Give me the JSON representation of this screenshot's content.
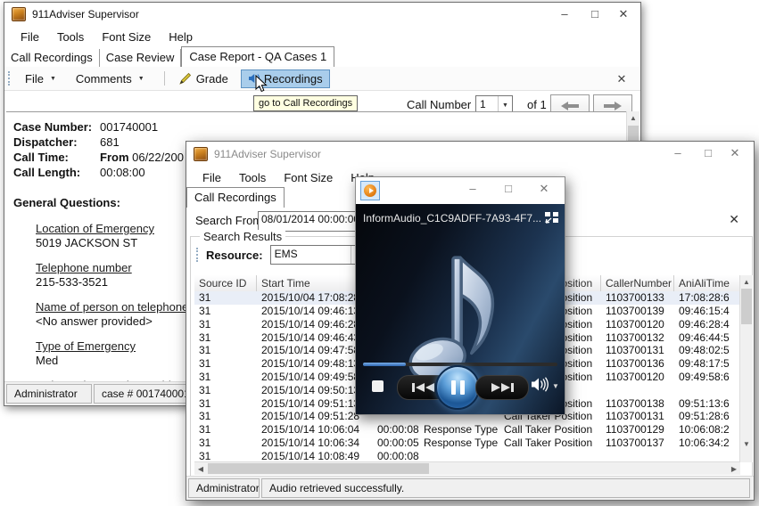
{
  "back_window": {
    "title": "911Adviser Supervisor",
    "menus": [
      "File",
      "Tools",
      "Font Size",
      "Help"
    ],
    "tabs": [
      "Call Recordings",
      "Case Review",
      "Case Report - QA Cases 1"
    ],
    "active_tab": "Case Report - QA Cases 1",
    "toolbar": {
      "file": "File",
      "comments": "Comments",
      "grade": "Grade",
      "recordings": "Recordings"
    },
    "tooltip": "go to Call Recordings",
    "call_nav": {
      "label": "Call Number",
      "value": "1",
      "count": "of 1"
    },
    "case_fields": [
      {
        "label": "Case Number:",
        "bold": "",
        "value": "001740001"
      },
      {
        "label": "Dispatcher:",
        "bold": "",
        "value": "681"
      },
      {
        "label": "Call Time:",
        "bold": "From",
        "value": " 06/22/200"
      },
      {
        "label": "Call Length:",
        "bold": "",
        "value": "00:08:00"
      }
    ],
    "section_title": "General Questions:",
    "questions": [
      {
        "q": "Location of Emergency",
        "a": "5019 JACKSON ST"
      },
      {
        "q": "Telephone number",
        "a": "215-533-3521"
      },
      {
        "q": "Name of person on telephone (Q",
        "a": "<No answer provided>"
      },
      {
        "q": "Type of Emergency",
        "a": "Med"
      },
      {
        "q": "Is the patient awake or able to ta",
        "a": ""
      }
    ],
    "status_user": "Administrator",
    "status_case": "case # 001740001"
  },
  "front_window": {
    "title": "911Adviser Supervisor",
    "menus": [
      "File",
      "Tools",
      "Font Size",
      "Help"
    ],
    "tab": "Call Recordings",
    "search": {
      "label": "Search From",
      "value": "08/01/2014 00:00:00"
    },
    "group_title": "Search Results",
    "resource": {
      "label": "Resource:",
      "value": "EMS"
    },
    "table": {
      "columns": [
        "Source ID",
        "Start Time",
        "",
        "",
        "Call Taker Position",
        "CallerNumber",
        "AniAliTime"
      ],
      "rows": [
        [
          "31",
          "2015/10/04 17:08:28",
          "",
          "",
          "Call Taker Position",
          "1103700133",
          "17:08:28:6"
        ],
        [
          "31",
          "2015/10/14 09:46:13",
          "",
          "",
          "Call Taker Position",
          "1103700139",
          "09:46:15:4"
        ],
        [
          "31",
          "2015/10/14 09:46:28",
          "",
          "",
          "Call Taker Position",
          "1103700120",
          "09:46:28:4"
        ],
        [
          "31",
          "2015/10/14 09:46:43",
          "",
          "",
          "Call Taker Position",
          "1103700132",
          "09:46:44:5"
        ],
        [
          "31",
          "2015/10/14 09:47:58",
          "",
          "",
          "Call Taker Position",
          "1103700131",
          "09:48:02:5"
        ],
        [
          "31",
          "2015/10/14 09:48:13",
          "",
          "",
          "Call Taker Position",
          "1103700136",
          "09:48:17:5"
        ],
        [
          "31",
          "2015/10/14 09:49:58",
          "",
          "",
          "Call Taker Position",
          "1103700120",
          "09:49:58:6"
        ],
        [
          "31",
          "2015/10/14 09:50:13",
          "",
          "",
          "",
          "",
          ""
        ],
        [
          "31",
          "2015/10/14 09:51:13",
          "",
          "",
          "Call Taker Position",
          "1103700138",
          "09:51:13:6"
        ],
        [
          "31",
          "2015/10/14 09:51:28",
          "",
          "",
          "Call Taker Position",
          "1103700131",
          "09:51:28:6"
        ],
        [
          "31",
          "2015/10/14 10:06:04",
          "00:00:08",
          "Response Type",
          "Call Taker Position",
          "1103700129",
          "10:06:08:2"
        ],
        [
          "31",
          "2015/10/14 10:06:34",
          "00:00:05",
          "Response Type",
          "Call Taker Position",
          "1103700137",
          "10:06:34:2"
        ],
        [
          "31",
          "2015/10/14 10:08:49",
          "00:00:08",
          "",
          "",
          "",
          ""
        ]
      ],
      "selected_row_index": 0
    },
    "status_user": "Administrator",
    "status_message": "Audio retrieved successfully."
  },
  "player": {
    "filename": "InformAudio_C1C9ADFF-7A93-4F7...",
    "progress_percent": 22,
    "state": "playing"
  },
  "colors": {
    "toolbar_highlight_bg": "#a9cdeb",
    "toolbar_highlight_border": "#5e93c3",
    "tooltip_bg": "#ffffe1",
    "player_accent_blue": "#2f66b0",
    "app_icon_orange": "#c97f1e"
  }
}
